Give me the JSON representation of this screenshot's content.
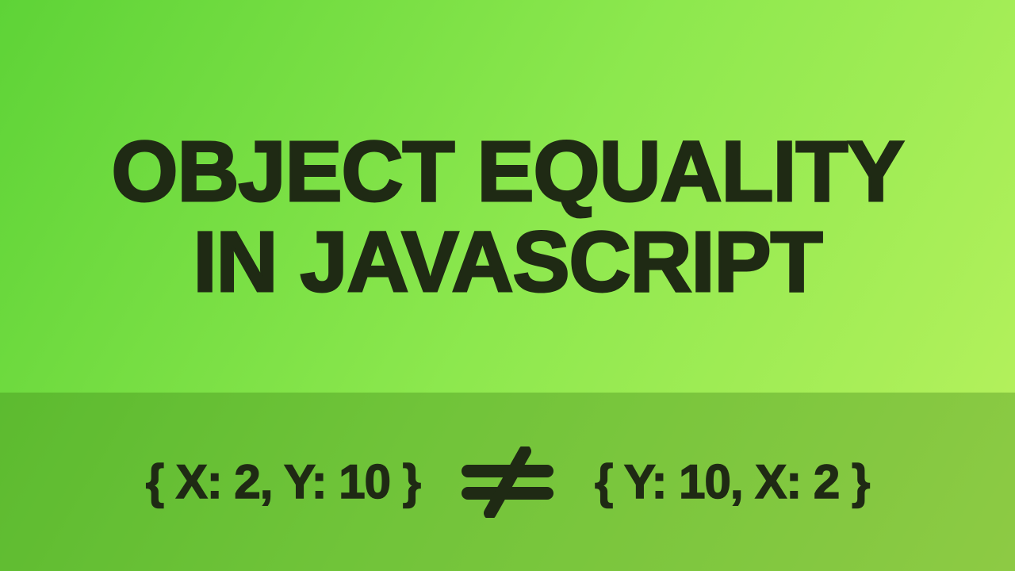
{
  "title": {
    "line1": "OBJECT EQUALITY",
    "line2": "IN JAVASCRIPT"
  },
  "example": {
    "left": "{ X: 2, Y: 10 }",
    "right": "{ Y: 10, X: 2 }",
    "operator": "not-equal"
  },
  "colors": {
    "text": "#1f2a14",
    "bg_gradient_start": "#5ed337",
    "bg_gradient_end": "#b9f25e",
    "band_overlay": "rgba(60,130,20,0.35)"
  }
}
